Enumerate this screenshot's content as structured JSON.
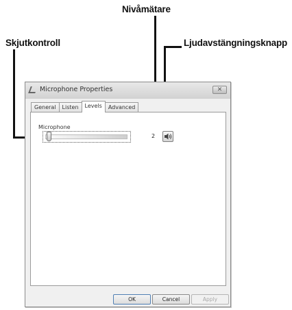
{
  "callouts": {
    "level_meter": "Nivåmätare",
    "slider": "Skjutkontroll",
    "mute_button": "Ljudavstängningsknapp"
  },
  "window": {
    "title": "Microphone Properties",
    "close_glyph": "✕",
    "tabs": [
      {
        "label": "General",
        "active": false
      },
      {
        "label": "Listen",
        "active": false
      },
      {
        "label": "Levels",
        "active": true
      },
      {
        "label": "Advanced",
        "active": false
      }
    ]
  },
  "levels": {
    "group_label": "Microphone",
    "level_value": "2",
    "slider_fraction": 0.02,
    "mute_icon": "speaker-icon"
  },
  "footer": {
    "ok_label": "OK",
    "cancel_label": "Cancel",
    "apply_label": "Apply"
  }
}
